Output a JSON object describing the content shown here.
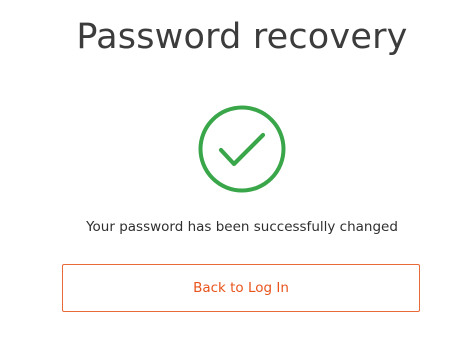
{
  "header": {
    "title": "Password recovery"
  },
  "status": {
    "icon": "checkmark-circle-icon",
    "icon_color": "#3aa64a",
    "message": "Your password has been successfully changed"
  },
  "actions": {
    "back_label": "Back to Log In",
    "accent_color": "#e8541c"
  }
}
